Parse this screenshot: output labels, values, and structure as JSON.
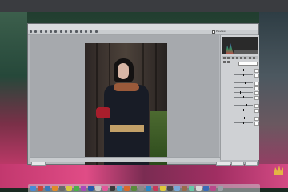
{
  "window": {
    "title": "",
    "preview_label": "Preview",
    "zoom": "",
    "buttons": {
      "save": "",
      "open": "",
      "cancel": "",
      "done": ""
    }
  },
  "panel": {
    "white_balance_label": "",
    "white_balance_value": "",
    "sliders": [
      {
        "label": "",
        "value": ""
      },
      {
        "label": "",
        "value": ""
      },
      {
        "label": "",
        "value": ""
      },
      {
        "label": "",
        "value": ""
      },
      {
        "label": "",
        "value": ""
      },
      {
        "label": "",
        "value": ""
      },
      {
        "label": "",
        "value": ""
      },
      {
        "label": "",
        "value": ""
      },
      {
        "label": "",
        "value": ""
      },
      {
        "label": "",
        "value": ""
      }
    ]
  },
  "top_strip": {
    "items": [
      "",
      "",
      "",
      "",
      ""
    ]
  },
  "dock": {
    "icons": [
      {
        "name": "finder-icon",
        "color": "#4a8ad4"
      },
      {
        "name": "app-icon",
        "color": "#c84a3a"
      },
      {
        "name": "app-icon",
        "color": "#3a7ab8"
      },
      {
        "name": "app-icon",
        "color": "#e08a2a"
      },
      {
        "name": "app-icon",
        "color": "#6a6a6a"
      },
      {
        "name": "app-icon",
        "color": "#d8c840"
      },
      {
        "name": "app-icon",
        "color": "#4ab04a"
      },
      {
        "name": "app-icon",
        "color": "#a84ab8"
      },
      {
        "name": "app-icon",
        "color": "#2a5aa8"
      },
      {
        "name": "app-icon",
        "color": "#c8c8c8"
      },
      {
        "name": "app-icon",
        "color": "#e05a9a"
      },
      {
        "name": "app-icon",
        "color": "#3a3a3a"
      },
      {
        "name": "app-icon",
        "color": "#48a8d8"
      },
      {
        "name": "app-icon",
        "color": "#d86a2a"
      },
      {
        "name": "app-icon",
        "color": "#5a8a3a"
      },
      {
        "name": "app-icon",
        "color": "#8a8a8a"
      },
      {
        "name": "app-icon",
        "color": "#2a8ac8"
      },
      {
        "name": "app-icon",
        "color": "#c83a5a"
      },
      {
        "name": "app-icon",
        "color": "#e0c83a"
      },
      {
        "name": "app-icon",
        "color": "#4a4a4a"
      },
      {
        "name": "app-icon",
        "color": "#78a8d8"
      },
      {
        "name": "app-icon",
        "color": "#9a6a4a"
      },
      {
        "name": "app-icon",
        "color": "#6ac8a8"
      },
      {
        "name": "app-icon",
        "color": "#d8d8d8"
      },
      {
        "name": "app-icon",
        "color": "#3a6ab8"
      },
      {
        "name": "app-icon",
        "color": "#b84a8a"
      },
      {
        "name": "trash-icon",
        "color": "#9aa0a6"
      }
    ]
  },
  "colors": {
    "window_bg": "#b6b9bd",
    "panel_bg": "#cfd1d4",
    "canvas_bg": "#a6a9ad"
  }
}
